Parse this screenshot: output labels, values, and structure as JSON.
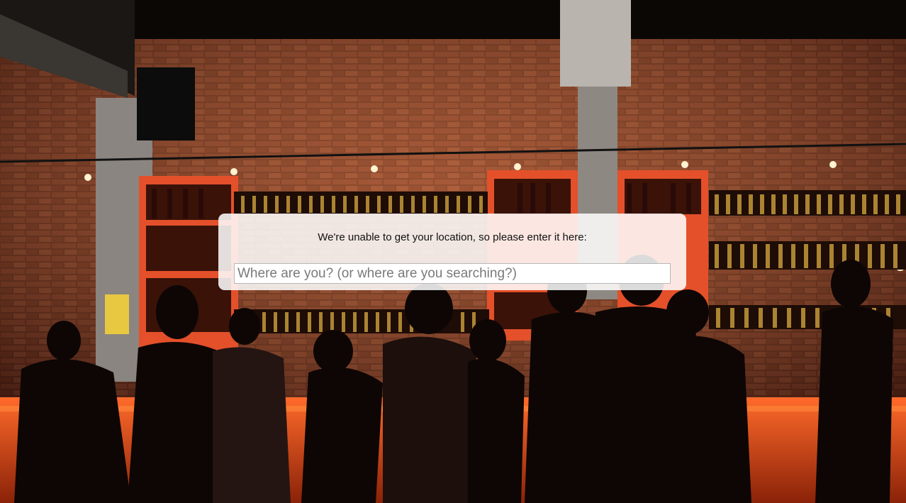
{
  "dialog": {
    "prompt": "We're unable to get your location, so please enter it here:",
    "input": {
      "value": "",
      "placeholder": "Where are you? (or where are you searching?)"
    }
  },
  "colors": {
    "brick": "#7a3320",
    "shelf_accent": "#e8532a",
    "bar_counter": "#d2461a",
    "dialog_bg": "#ffffff"
  }
}
